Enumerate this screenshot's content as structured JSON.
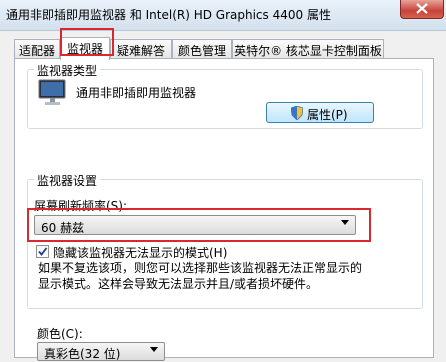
{
  "window": {
    "title": "通用非即插即用监视器 和 Intel(R) HD Graphics 4400 属性"
  },
  "tabs": [
    {
      "label": "适配器"
    },
    {
      "label": "监视器"
    },
    {
      "label": "疑难解答"
    },
    {
      "label": "颜色管理"
    },
    {
      "label": "英特尔® 核芯显卡控制面板"
    }
  ],
  "monitor_type": {
    "group_title": "监视器类型",
    "monitor_name": "通用非即插即用监视器",
    "properties_button": "属性(P)"
  },
  "monitor_settings": {
    "group_title": "监视器设置",
    "refresh_label": "屏幕刷新频率(S):",
    "refresh_value": "60 赫兹",
    "hide_modes_label": "隐藏该监视器无法显示的模式(H)",
    "hide_modes_checked": true,
    "description_line1": "如果不复选该项，则您可以选择那些该监视器无法正常显示的",
    "description_line2": "显示模式。这样会导致无法显示并且/或者损坏硬件。"
  },
  "color": {
    "label": "颜色(C):",
    "value": "真彩色(32 位)"
  },
  "colors": {
    "highlight": "#d9282f",
    "accent": "#3c7fb1"
  }
}
